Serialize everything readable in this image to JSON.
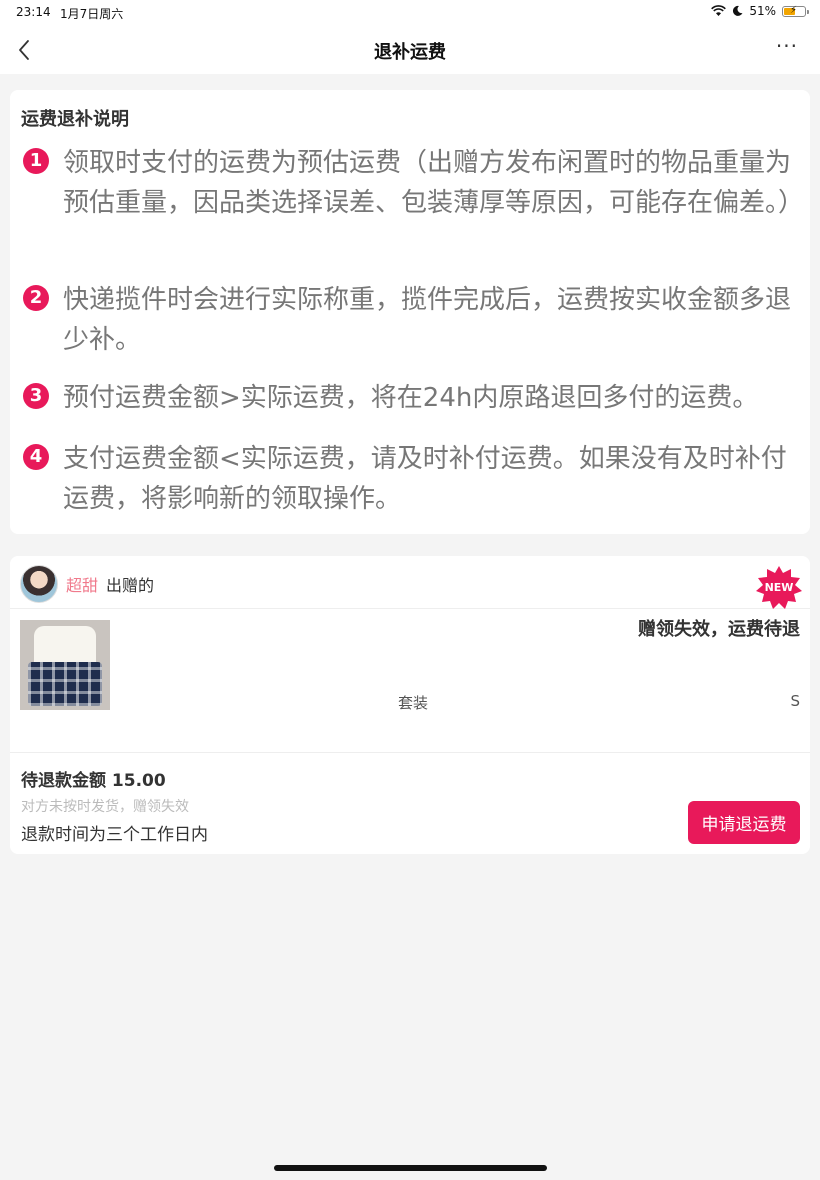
{
  "status_bar": {
    "time": "23:14",
    "date": "1月7日周六",
    "battery": "51%",
    "battery_level": 0.51,
    "icons": [
      "wifi-icon",
      "moon-icon",
      "battery-icon"
    ]
  },
  "nav": {
    "title": "退补运费",
    "more": "···",
    "icons": [
      "back-icon",
      "more-icon"
    ]
  },
  "explain": {
    "title": "运费退补说明",
    "rules": [
      {
        "num": "1",
        "text": "领取时支付的运费为预估运费（出赠方发布闲置时的物品重量为预估重量，因品类选择误差、包装薄厚等原因，可能存在偏差。）"
      },
      {
        "num": "2",
        "text": "快递揽件时会进行实际称重，揽件完成后，运费按实收金额多退少补。"
      },
      {
        "num": "3",
        "text": "预付运费金额>实际运费，将在24h内原路退回多付的运费。"
      },
      {
        "num": "4",
        "text": "支付运费金额<实际运费，请及时补付运费。如果没有及时补付运费，将影响新的领取操作。"
      }
    ]
  },
  "order": {
    "giver_name": "超甜",
    "giver_suffix": "出赠的",
    "badge": "NEW",
    "status": "赠领失效，运费待退",
    "product_name": "套装",
    "product_size": "S",
    "refund_label": "待退款金额 15.00",
    "refund_reason": "对方未按时发货，赠领失效",
    "refund_time": "退款时间为三个工作日内",
    "apply_button": "申请退运费"
  },
  "colors": {
    "accent": "#e8195a",
    "giver_name": "#f07a8c",
    "background": "#f4f4f4"
  }
}
